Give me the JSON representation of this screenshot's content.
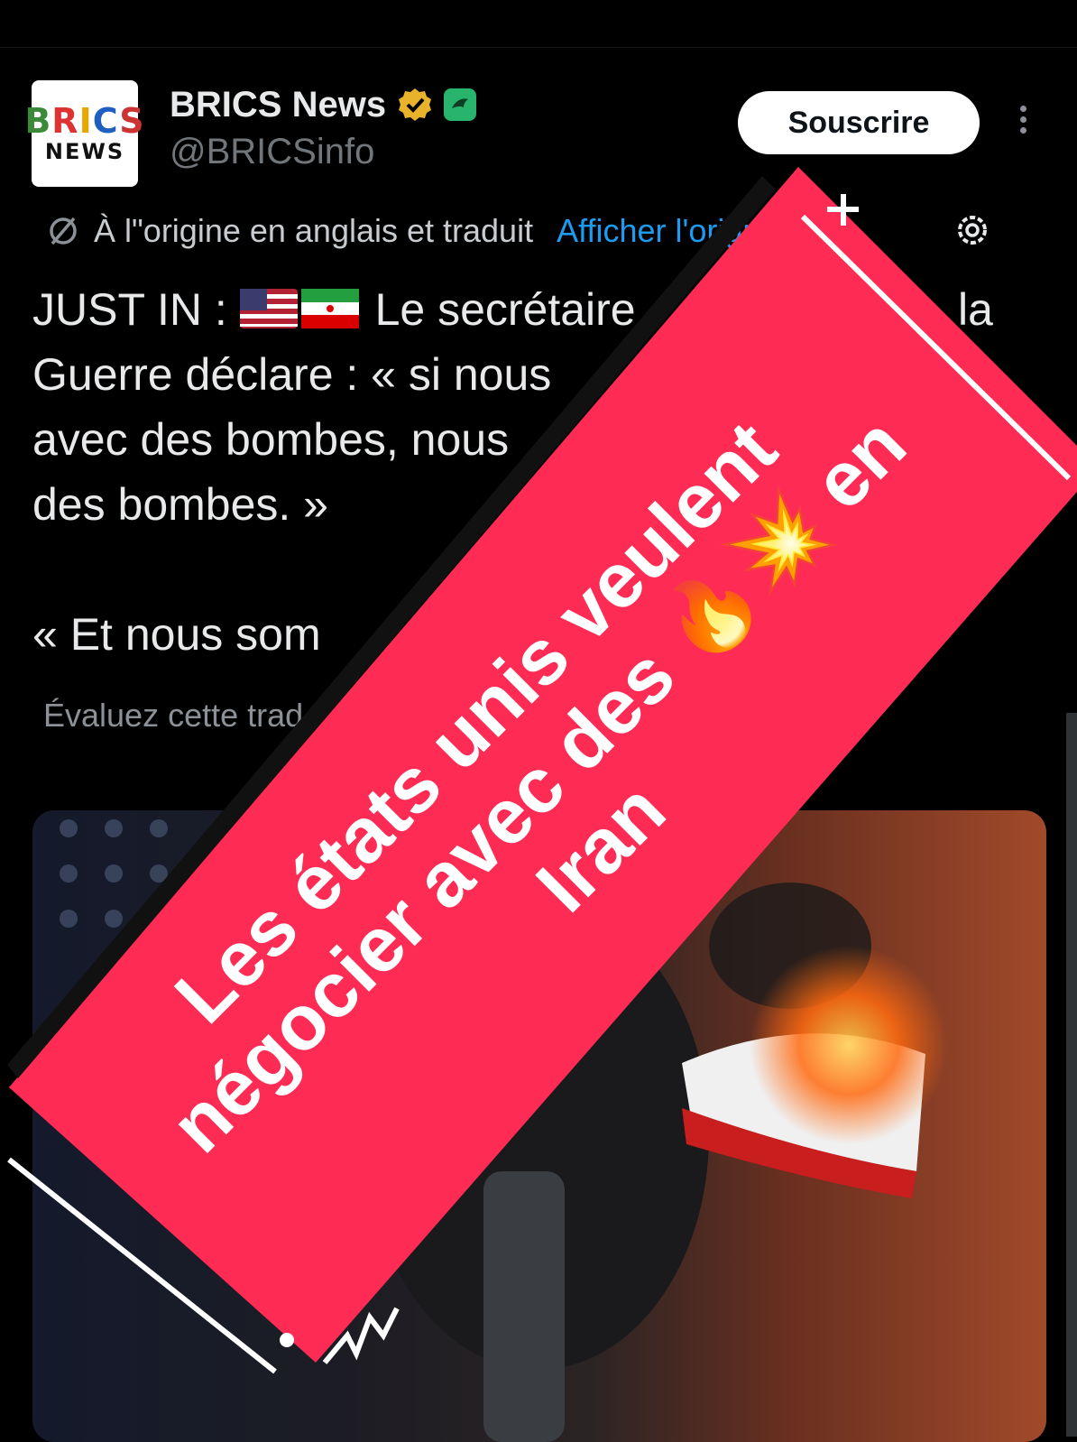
{
  "account": {
    "avatar_line1": "BRICS",
    "avatar_line2": "NEWS",
    "name": "BRICS News",
    "handle": "@BRICSinfo",
    "subscribe_label": "Souscrire"
  },
  "translation": {
    "note": "À l\"origine en anglais et traduit",
    "link": "Afficher l'original"
  },
  "post": {
    "line1_prefix": "JUST IN : ",
    "line1_rest": " Le secrétaire",
    "line1_end": "la",
    "line2": "Guerre déclare : « si nous",
    "line3": "avec des bombes, nous",
    "line4": "des bombes. »",
    "line5": "« Et nous som",
    "rate_label": "Évaluez cette trad"
  },
  "overlay": {
    "banner_text": "Les états unis veulent négocier avec des 🔥💥 en Iran",
    "accent_color": "#fe2c55"
  },
  "icons": [
    "verified-badge-icon",
    "affiliate-badge-icon",
    "more-icon",
    "translate-icon",
    "settings-gear-icon",
    "us-flag-icon",
    "iran-flag-icon"
  ]
}
